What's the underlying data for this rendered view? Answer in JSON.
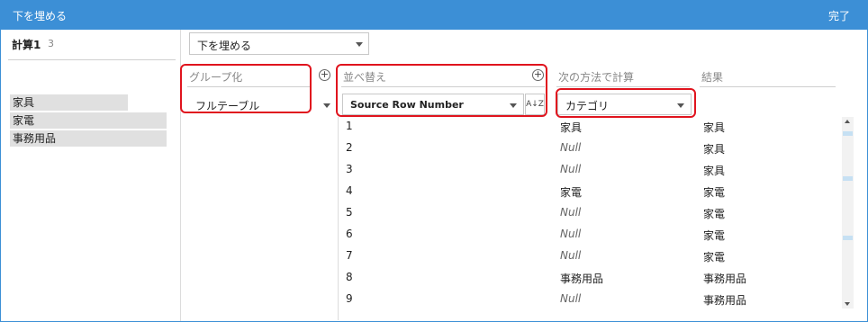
{
  "window": {
    "title": "下を埋める",
    "done_label": "完了"
  },
  "calculation": {
    "name": "計算1",
    "count": "3"
  },
  "categories": [
    "家具",
    "家電",
    "事務用品"
  ],
  "function_select": {
    "value": "下を埋める"
  },
  "columns": {
    "group_by": {
      "label": "グループ化",
      "value": "フルテーブル"
    },
    "sort_by": {
      "label": "並べ替え",
      "value": "Source Row Number",
      "sort_icon_text": "A↓Z"
    },
    "compute_by": {
      "label": "次の方法で計算",
      "value": "カテゴリ"
    },
    "result": {
      "label": "結果"
    }
  },
  "rows": [
    {
      "num": "1",
      "category": "家具",
      "result": "家具",
      "null": false
    },
    {
      "num": "2",
      "category": "Null",
      "result": "家具",
      "null": true
    },
    {
      "num": "3",
      "category": "Null",
      "result": "家具",
      "null": true
    },
    {
      "num": "4",
      "category": "家電",
      "result": "家電",
      "null": false
    },
    {
      "num": "5",
      "category": "Null",
      "result": "家電",
      "null": true
    },
    {
      "num": "6",
      "category": "Null",
      "result": "家電",
      "null": true
    },
    {
      "num": "7",
      "category": "Null",
      "result": "家電",
      "null": true
    },
    {
      "num": "8",
      "category": "事務用品",
      "result": "事務用品",
      "null": false
    },
    {
      "num": "9",
      "category": "Null",
      "result": "事務用品",
      "null": true
    }
  ],
  "colors": {
    "accent": "#3c8fd6",
    "highlight": "#e0141e",
    "category_bg": "#e0e0e0"
  }
}
